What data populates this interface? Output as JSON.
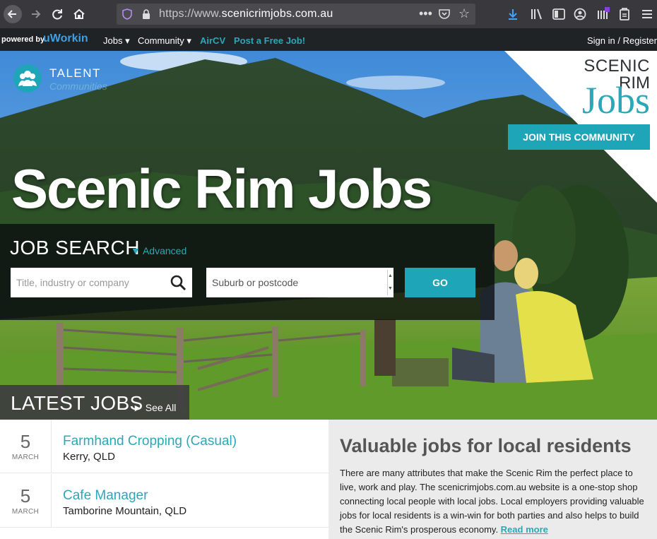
{
  "browser": {
    "url_prefix": "https://www.",
    "url_domain": "scenicrimjobs.com.au",
    "menu_dots": "•••",
    "star": "☆"
  },
  "sitebar": {
    "powered_by": "powered by",
    "brand": "uWorkin",
    "nav": [
      {
        "label": "Jobs ▾"
      },
      {
        "label": "Community ▾"
      },
      {
        "label": "AirCV"
      },
      {
        "label": "Post a Free Job!"
      }
    ],
    "signin": "Sign in / Register"
  },
  "hero": {
    "talent_logo_text": "TALENT",
    "talent_logo_sub": "Communities",
    "brand_line1": "SCENIC",
    "brand_line2": "RIM",
    "brand_line3": "Jobs",
    "join_button": "JOIN THIS COMMUNITY",
    "title": "Scenic Rim Jobs"
  },
  "search": {
    "title": "JOB SEARCH",
    "advanced": "▼ Advanced",
    "keyword_placeholder": "Title, industry or company",
    "location_placeholder": "Suburb or postcode",
    "go_button": "GO"
  },
  "latest": {
    "title": "LATEST JOBS",
    "see_all": "► See All"
  },
  "jobs": [
    {
      "day": "5",
      "month": "MARCH",
      "title": "Farmhand Cropping (Casual)",
      "location": "Kerry, QLD"
    },
    {
      "day": "5",
      "month": "MARCH",
      "title": "Cafe Manager",
      "location": "Tamborine Mountain, QLD"
    }
  ],
  "info": {
    "heading": "Valuable jobs for local residents",
    "body": "There are many attributes that make the Scenic Rim the perfect place to live, work and play. The scenicrimjobs.com.au website is a one-stop shop connecting local people with local jobs. Local employers providing valuable jobs for local residents is a win-win for both parties and also helps to build the Scenic Rim's prosperous economy. ",
    "read_more": "Read more"
  },
  "colors": {
    "accent": "#1ea6b8",
    "sitebar": "#1f2326",
    "chrome": "#38383d"
  }
}
